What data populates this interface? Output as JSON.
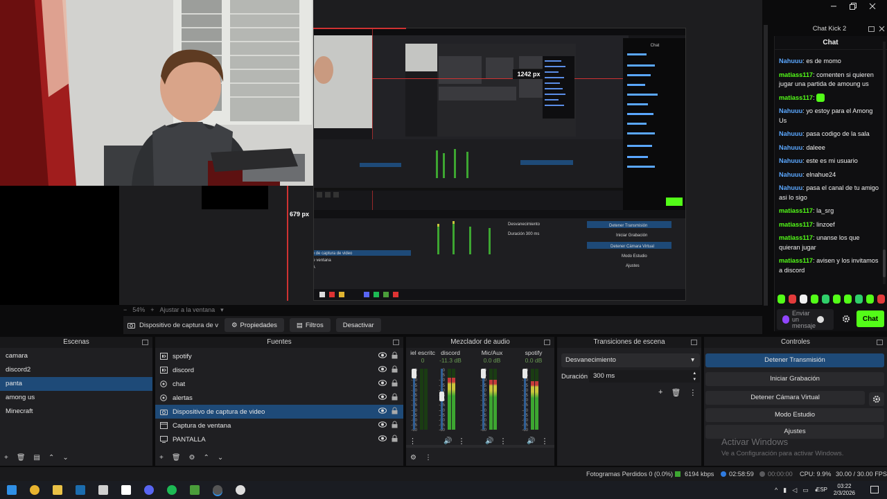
{
  "window": {
    "caption_buttons": [
      "minimize",
      "maximize",
      "close"
    ]
  },
  "preview": {
    "zoom_label": "54%",
    "zoom_fit": "Ajustar a la ventana",
    "nested_measure_1": "1242 px",
    "nested_measure_2": "679 px"
  },
  "chat": {
    "window_title": "Chat Kick 2",
    "header": "Chat",
    "messages": [
      {
        "user": "Nahuuu",
        "text": "es de momo",
        "color": "#5aa7ff"
      },
      {
        "user": "matiass117",
        "text": "comenten si quieren jugar una partida de amoung us",
        "color": "#53fc18"
      },
      {
        "user": "matiass117",
        "text": "",
        "emote": true,
        "color": "#53fc18"
      },
      {
        "user": "Nahuuu",
        "text": "yo estoy para el Among Us",
        "color": "#5aa7ff"
      },
      {
        "user": "Nahuuu",
        "text": "pasa codigo de la sala",
        "color": "#5aa7ff"
      },
      {
        "user": "Nahuuu",
        "text": "daleee",
        "color": "#5aa7ff"
      },
      {
        "user": "Nahuuu",
        "text": "este es mi usuario",
        "color": "#5aa7ff"
      },
      {
        "user": "Nahuuu",
        "text": "elnahue24",
        "color": "#5aa7ff"
      },
      {
        "user": "Nahuuu",
        "text": "pasa el canal de tu amigo asi lo sigo",
        "color": "#5aa7ff"
      },
      {
        "user": "matiass117",
        "text": "la_srg",
        "color": "#53fc18"
      },
      {
        "user": "matiass117",
        "text": "linzoef",
        "color": "#53fc18"
      },
      {
        "user": "matiass117",
        "text": "unanse los que quieran jugar",
        "color": "#53fc18"
      },
      {
        "user": "matiass117",
        "text": "avisen y los invitamos a discord",
        "color": "#53fc18"
      }
    ],
    "input_placeholder": "Enviar un mensaje",
    "send_label": "Chat",
    "emote_colors": [
      "#53fc18",
      "#e23b3b",
      "#f0f0f0",
      "#53fc18",
      "#2fcf6a",
      "#53fc18",
      "#53fc18",
      "#2fcf6a",
      "#53fc18",
      "#e23b3b"
    ]
  },
  "source_toolbar": {
    "source_name": "Dispositivo de captura de v",
    "properties": "Propiedades",
    "filters": "Filtros",
    "deactivate": "Desactivar"
  },
  "scenes": {
    "title": "Escenas",
    "items": [
      {
        "label": "camara",
        "selected": false
      },
      {
        "label": "discord2",
        "selected": false
      },
      {
        "label": "panta",
        "selected": true
      },
      {
        "label": "among us",
        "selected": false
      },
      {
        "label": "Minecraft",
        "selected": false
      }
    ]
  },
  "sources": {
    "title": "Fuentes",
    "items": [
      {
        "label": "spotify",
        "icon": "audio-output-icon",
        "selected": false
      },
      {
        "label": "discord",
        "icon": "audio-output-icon",
        "selected": false
      },
      {
        "label": "chat",
        "icon": "browser-source-icon",
        "selected": false
      },
      {
        "label": "alertas",
        "icon": "browser-source-icon",
        "selected": false
      },
      {
        "label": "Dispositivo de captura de video",
        "icon": "camera-icon",
        "selected": true
      },
      {
        "label": "Captura de ventana",
        "icon": "window-capture-icon",
        "selected": false
      },
      {
        "label": "PANTALLA",
        "icon": "display-capture-icon",
        "selected": false
      }
    ]
  },
  "mixer": {
    "title": "Mezclador de audio",
    "channels": [
      {
        "name": "iel escritc",
        "db": "0",
        "level": 0.0,
        "fader": 1.0
      },
      {
        "name": "discord",
        "db": "-11.3 dB",
        "level": 0.85,
        "fader": 0.55
      },
      {
        "name": "Mic/Aux",
        "db": "0.0 dB",
        "level": 0.82,
        "fader": 1.0
      },
      {
        "name": "spotify",
        "db": "0.0 dB",
        "level": 0.8,
        "fader": 1.0
      }
    ],
    "scale": [
      "0",
      "-5",
      "-10",
      "-15",
      "-20",
      "-25",
      "-30",
      "-35",
      "-40",
      "-45",
      "-50",
      "-55",
      "-60"
    ]
  },
  "transitions": {
    "title": "Transiciones de escena",
    "selected": "Desvanecimiento",
    "duration_label": "Duración",
    "duration_value": "300 ms"
  },
  "controls": {
    "title": "Controles",
    "stop_stream": "Detener Transmisión",
    "start_recording": "Iniciar Grabación",
    "stop_vcam": "Detener Cámara Virtual",
    "studio_mode": "Modo Estudio",
    "settings": "Ajustes"
  },
  "watermark": {
    "line1": "Activar Windows",
    "line2": "Ve a Configuración para activar Windows."
  },
  "status": {
    "dropped": "Fotogramas Perdidos 0 (0.0%)",
    "bitrate": "6194 kbps",
    "stream_time": "02:58:59",
    "rec_time": "00:00:00",
    "cpu": "CPU: 9.9%",
    "fps": "30.00 / 30.00 FPS"
  },
  "taskbar": {
    "lang": "ESP",
    "time": "03:22",
    "date": "2/3/2026",
    "apps": [
      "windows",
      "chrome",
      "explorer",
      "steam",
      "epic",
      "capcut",
      "discord",
      "spotify",
      "minecraft",
      "obs",
      "settings"
    ]
  }
}
